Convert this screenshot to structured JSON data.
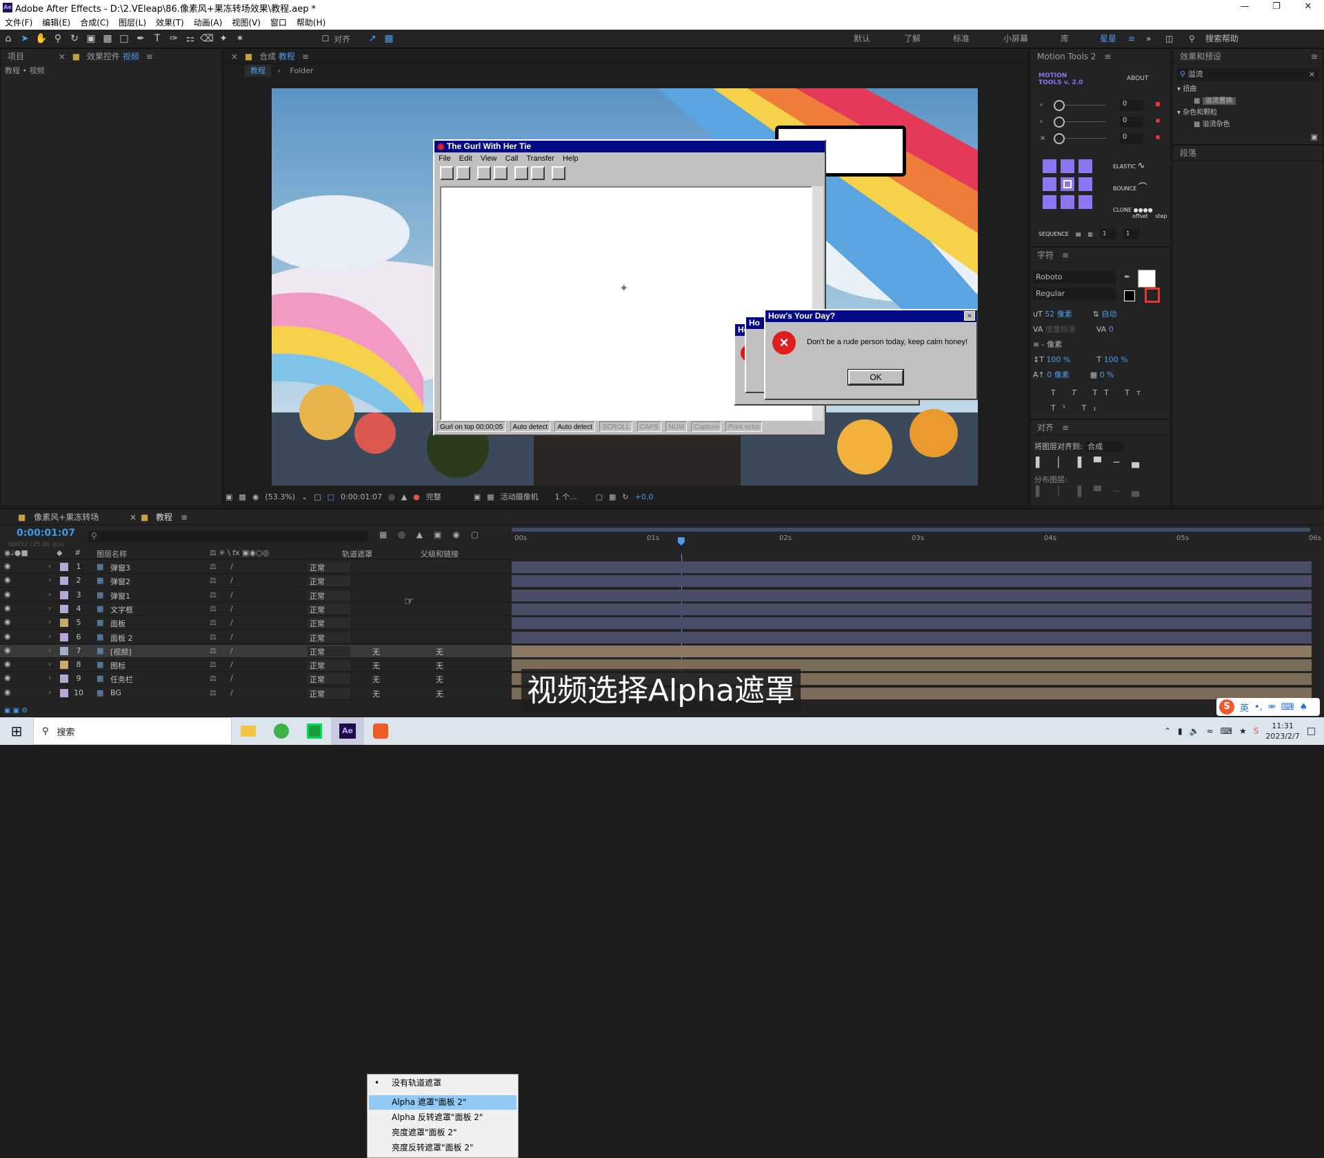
{
  "window": {
    "title": "Adobe After Effects - D:\\2.VEleap\\86.像素风+果冻转场效果\\教程.aep *",
    "app_icon": "Ae"
  },
  "menu": [
    "文件(F)",
    "编辑(E)",
    "合成(C)",
    "图层(L)",
    "效果(T)",
    "动画(A)",
    "视图(V)",
    "窗口",
    "帮助(H)"
  ],
  "toolbar": {
    "align_label": "对齐",
    "workspaces": [
      "默认",
      "了解",
      "标准",
      "小屏幕",
      "库",
      "星星"
    ],
    "search_help": "搜索帮助"
  },
  "project_panel": {
    "tab_project": "项目",
    "tab_effects": "效果控件",
    "tab_effects_target": "视频",
    "breadcrumb": "教程 • 视频"
  },
  "comp_panel": {
    "tab_prefix": "合成",
    "tab_name": "教程",
    "nav_current": "教程",
    "nav_folder": "Folder"
  },
  "viewer": {
    "main_window_title": "The Gurl With Her Tie",
    "main_menu": [
      "File",
      "Edit",
      "View",
      "Call",
      "Transfer",
      "Help"
    ],
    "status_cells": [
      "Gurl on top 00;00;05",
      "Auto detect",
      "Auto detect",
      "SCROLL",
      "CAPS",
      "NUM",
      "Capture",
      "Print echo"
    ],
    "dialog_title": "How's Your Day?",
    "dialog_message": "Don't be a rude person today, keep calm honey!",
    "dialog_ok": "OK",
    "behind_title_1": "Ho",
    "behind_title_2": "Ho"
  },
  "view_controls": {
    "zoom": "(53.3%)",
    "timecode": "0:00:01:07",
    "resolution": "完整",
    "camera": "活动摄像机",
    "views": "1 个...",
    "exposure": "+0.0"
  },
  "motion_tools": {
    "tab": "Motion Tools 2",
    "logo_line1": "MOTION",
    "logo_line2": "TOOLS v. 2.0",
    "about": "ABOUT",
    "values": [
      "0",
      "0",
      "0"
    ],
    "elastic": "ELASTIC",
    "bounce": "BOUNCE",
    "clone": "CLONE",
    "offset": "offset",
    "step": "step",
    "sequence": "SEQUENCE",
    "seq_values": [
      "1",
      "1"
    ]
  },
  "character": {
    "tab": "字符",
    "font": "Roboto",
    "style": "Regular",
    "size": "52 像素",
    "leading": "自动",
    "kerning": "度量标准",
    "tracking": "0",
    "stroke": "- 像素",
    "vscale": "100 %",
    "hscale": "100 %",
    "baseline": "0 像素",
    "tsume": "0 %"
  },
  "align": {
    "tab": "对齐",
    "align_to_label": "将图层对齐到:",
    "align_to_value": "合成",
    "distribute": "分布图层:"
  },
  "effects_presets": {
    "tab": "效果和预设",
    "search": "溢流",
    "groups": [
      {
        "name": "扭曲",
        "items": [
          "溢流置换"
        ]
      },
      {
        "name": "杂色和颗粒",
        "items": [
          "溢流杂色"
        ]
      }
    ],
    "paragraph_tab": "段落"
  },
  "timeline": {
    "tabs": [
      "像素风+果冻转场",
      "教程"
    ],
    "timecode": "0:00:01:07",
    "fps": "00032 (25.00 fps)",
    "headers": {
      "num": "#",
      "name": "图层名称",
      "track_matte": "轨道遮罩",
      "parent": "父级和链接"
    },
    "ruler": [
      "00s",
      "01s",
      "02s",
      "03s",
      "04s",
      "05s",
      "06s"
    ],
    "playhead_seconds": 1.28,
    "layers": [
      {
        "num": "1",
        "name": "弹窗3",
        "mode": "正常",
        "track": "",
        "parent": ""
      },
      {
        "num": "2",
        "name": "弹窗2",
        "mode": "正常",
        "track": "",
        "parent": ""
      },
      {
        "num": "3",
        "name": "弹窗1",
        "mode": "正常",
        "track": "",
        "parent": ""
      },
      {
        "num": "4",
        "name": "文字框",
        "mode": "正常",
        "track": "",
        "parent": ""
      },
      {
        "num": "5",
        "name": "面板",
        "mode": "正常",
        "track": "",
        "parent": ""
      },
      {
        "num": "6",
        "name": "面板 2",
        "mode": "正常",
        "track": "",
        "parent": ""
      },
      {
        "num": "7",
        "name": "[视频]",
        "mode": "正常",
        "track": "无",
        "parent": "无"
      },
      {
        "num": "8",
        "name": "图标",
        "mode": "正常",
        "track": "无",
        "parent": "无"
      },
      {
        "num": "9",
        "name": "任务栏",
        "mode": "正常",
        "track": "无",
        "parent": "无"
      },
      {
        "num": "10",
        "name": "BG",
        "mode": "正常",
        "track": "无",
        "parent": "无"
      }
    ],
    "context_menu": [
      "没有轨道遮罩",
      "Alpha 遮罩\"面板 2\"",
      "Alpha 反转遮罩\"面板 2\"",
      "亮度遮罩\"面板 2\"",
      "亮度反转遮罩\"面板 2\""
    ]
  },
  "caption": "视频选择Alpha遮罩",
  "taskbar": {
    "search": "搜索",
    "time": "11:31",
    "date": "2023/2/7",
    "ime": "英"
  },
  "colors": {
    "accent": "#2d8ceb",
    "timecode": "#3b9be8",
    "layer_bar": "#4a4d68",
    "video_bar": "#8a7a62",
    "menu_highlight": "#91c9f7"
  }
}
